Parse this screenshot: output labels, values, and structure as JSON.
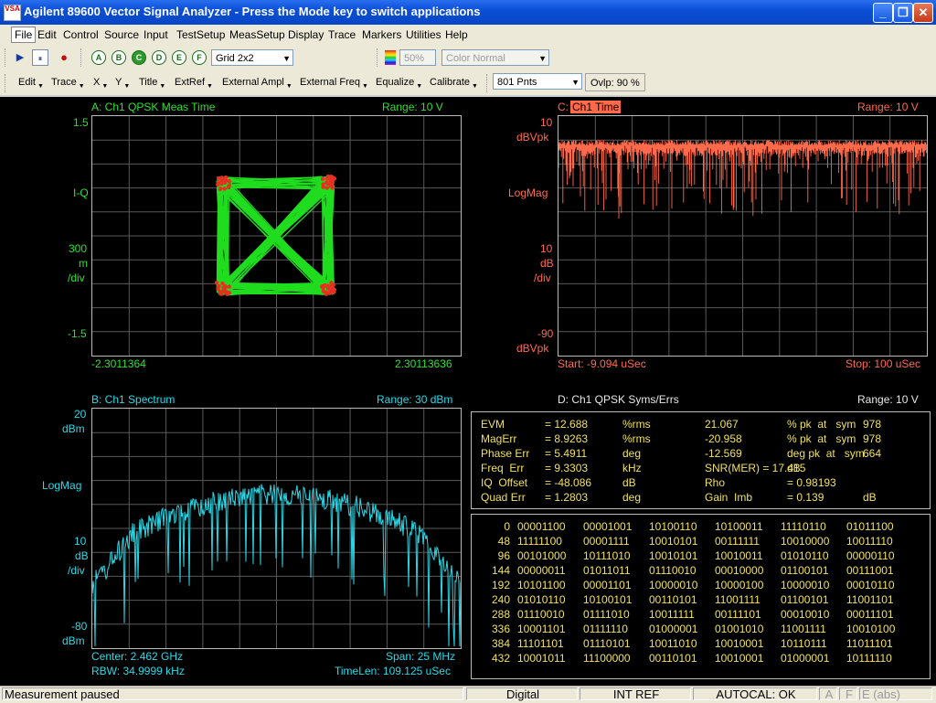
{
  "window": {
    "title": "Agilent 89600 Vector Signal Analyzer - Press the Mode key to switch applications",
    "app_icon_text": "VSA",
    "min_label": "_",
    "max_label": "❐",
    "close_label": "✕"
  },
  "menu": [
    "File",
    "Edit",
    "Control",
    "Source",
    "Input",
    "TestSetup",
    "MeasSetup",
    "Display",
    "Trace",
    "Markers",
    "Utilities",
    "Help"
  ],
  "toolbar1": {
    "play": "▶",
    "pause": "⏸",
    "record": "●",
    "traces": [
      "A",
      "B",
      "C",
      "D",
      "E",
      "F"
    ],
    "active_trace": "C",
    "grid_select": "Grid 2x2",
    "percent_select": "50%",
    "color_select": "Color Normal"
  },
  "toolbar2": {
    "menus": [
      "Edit",
      "Trace",
      "X",
      "Y",
      "Title",
      "ExtRef",
      "External Ampl",
      "External Freq",
      "Equalize",
      "Calibrate"
    ],
    "points_select": "801 Pnts",
    "ovlp": "Ovlp: 90 %"
  },
  "traceA": {
    "title": "A: Ch1 QPSK Meas Time",
    "range": "Range: 10  V",
    "y_top": "1.5",
    "y_fmt": "I-Q",
    "y_scale1": "300",
    "y_scale2": "m",
    "y_scale3": "/div",
    "y_bot": "-1.5",
    "x_left": "-2.3011364",
    "x_right": "2.30113636",
    "colors": {
      "trace": "#1fdc1f",
      "symbol": "#e83020"
    }
  },
  "traceC": {
    "title_prefix": "C:",
    "title": "Ch1 Time",
    "range": "Range: 10  V",
    "y_top1": "10",
    "y_top2": "dBVpk",
    "y_fmt": "LogMag",
    "y_scale1": "10",
    "y_scale2": "dB",
    "y_scale3": "/div",
    "y_bot1": "-90",
    "y_bot2": "dBVpk",
    "start": "Start: -9.094  uSec",
    "stop": "Stop: 100  uSec",
    "colors": {
      "trace": "#ff6a4a"
    }
  },
  "traceB": {
    "title": "B: Ch1 Spectrum",
    "range": "Range: 30  dBm",
    "y_top1": "20",
    "y_top2": "dBm",
    "y_fmt": "LogMag",
    "y_scale1": "10",
    "y_scale2": "dB",
    "y_scale3": "/div",
    "y_bot1": "-80",
    "y_bot2": "dBm",
    "center": "Center: 2.462  GHz",
    "span": "Span: 25  MHz",
    "rbw": "RBW: 34.9999  kHz",
    "timelen": "TimeLen: 109.125  uSec",
    "colors": {
      "trace": "#29d9e9"
    }
  },
  "traceD": {
    "title": "D: Ch1 QPSK Syms/Errs",
    "range": "Range: 10  V",
    "rows": [
      {
        "k": "EVM",
        "v": "= 12.688",
        "u": "%rms",
        "k2": "21.067",
        "u2": "% pk  at   sym",
        "v2": "978"
      },
      {
        "k": "MagErr",
        "v": "= 8.9263",
        "u": "%rms",
        "k2": "-20.958",
        "u2": "% pk  at   sym",
        "v2": "978"
      },
      {
        "k": "Phase Err",
        "v": "= 5.4911",
        "u": "deg",
        "k2": "-12.569",
        "u2": "deg pk  at   sym",
        "v2": "664"
      },
      {
        "k": "Freq  Err",
        "v": "= 9.3303",
        "u": "kHz",
        "k2": "SNR(MER) = 17.415",
        "u2": "dB",
        "v2": ""
      },
      {
        "k": "IQ  Offset",
        "v": "= -48.086",
        "u": "dB",
        "k2": "Rho",
        "u2": "= 0.98193",
        "v2": ""
      },
      {
        "k": "Quad Err",
        "v": "= 1.2803",
        "u": "deg",
        "k2": "Gain  Imb",
        "u2": "= 0.139",
        "v2": "dB"
      }
    ],
    "symbols": [
      {
        "i": "0",
        "b": [
          "00001100",
          "00001001",
          "10100110",
          "10100011",
          "11110110",
          "01011100"
        ]
      },
      {
        "i": "48",
        "b": [
          "11111100",
          "00001111",
          "10010101",
          "00111111",
          "10010000",
          "10011110"
        ]
      },
      {
        "i": "96",
        "b": [
          "00101000",
          "10111010",
          "10010101",
          "10010011",
          "01010110",
          "00000110"
        ]
      },
      {
        "i": "144",
        "b": [
          "00000011",
          "01011011",
          "01110010",
          "00010000",
          "01100101",
          "00111001"
        ]
      },
      {
        "i": "192",
        "b": [
          "10101100",
          "00001101",
          "10000010",
          "10000100",
          "10000010",
          "00010110"
        ]
      },
      {
        "i": "240",
        "b": [
          "01010110",
          "10100101",
          "00110101",
          "11001111",
          "01100101",
          "11001101"
        ]
      },
      {
        "i": "288",
        "b": [
          "01110010",
          "01111010",
          "10011111",
          "00111101",
          "00010010",
          "00011101"
        ]
      },
      {
        "i": "336",
        "b": [
          "10001101",
          "01111110",
          "01000001",
          "01001010",
          "11001111",
          "10010100"
        ]
      },
      {
        "i": "384",
        "b": [
          "11101101",
          "01110101",
          "10011010",
          "10010001",
          "10110111",
          "11011101"
        ]
      },
      {
        "i": "432",
        "b": [
          "10001011",
          "11100000",
          "00110101",
          "10010001",
          "01000001",
          "10111110"
        ]
      }
    ]
  },
  "status": {
    "message": "Measurement paused",
    "mode": "Digital",
    "ref": "INT REF",
    "autocal": "AUTOCAL: OK",
    "a": "A",
    "f": "F",
    "e": "E (abs)"
  }
}
